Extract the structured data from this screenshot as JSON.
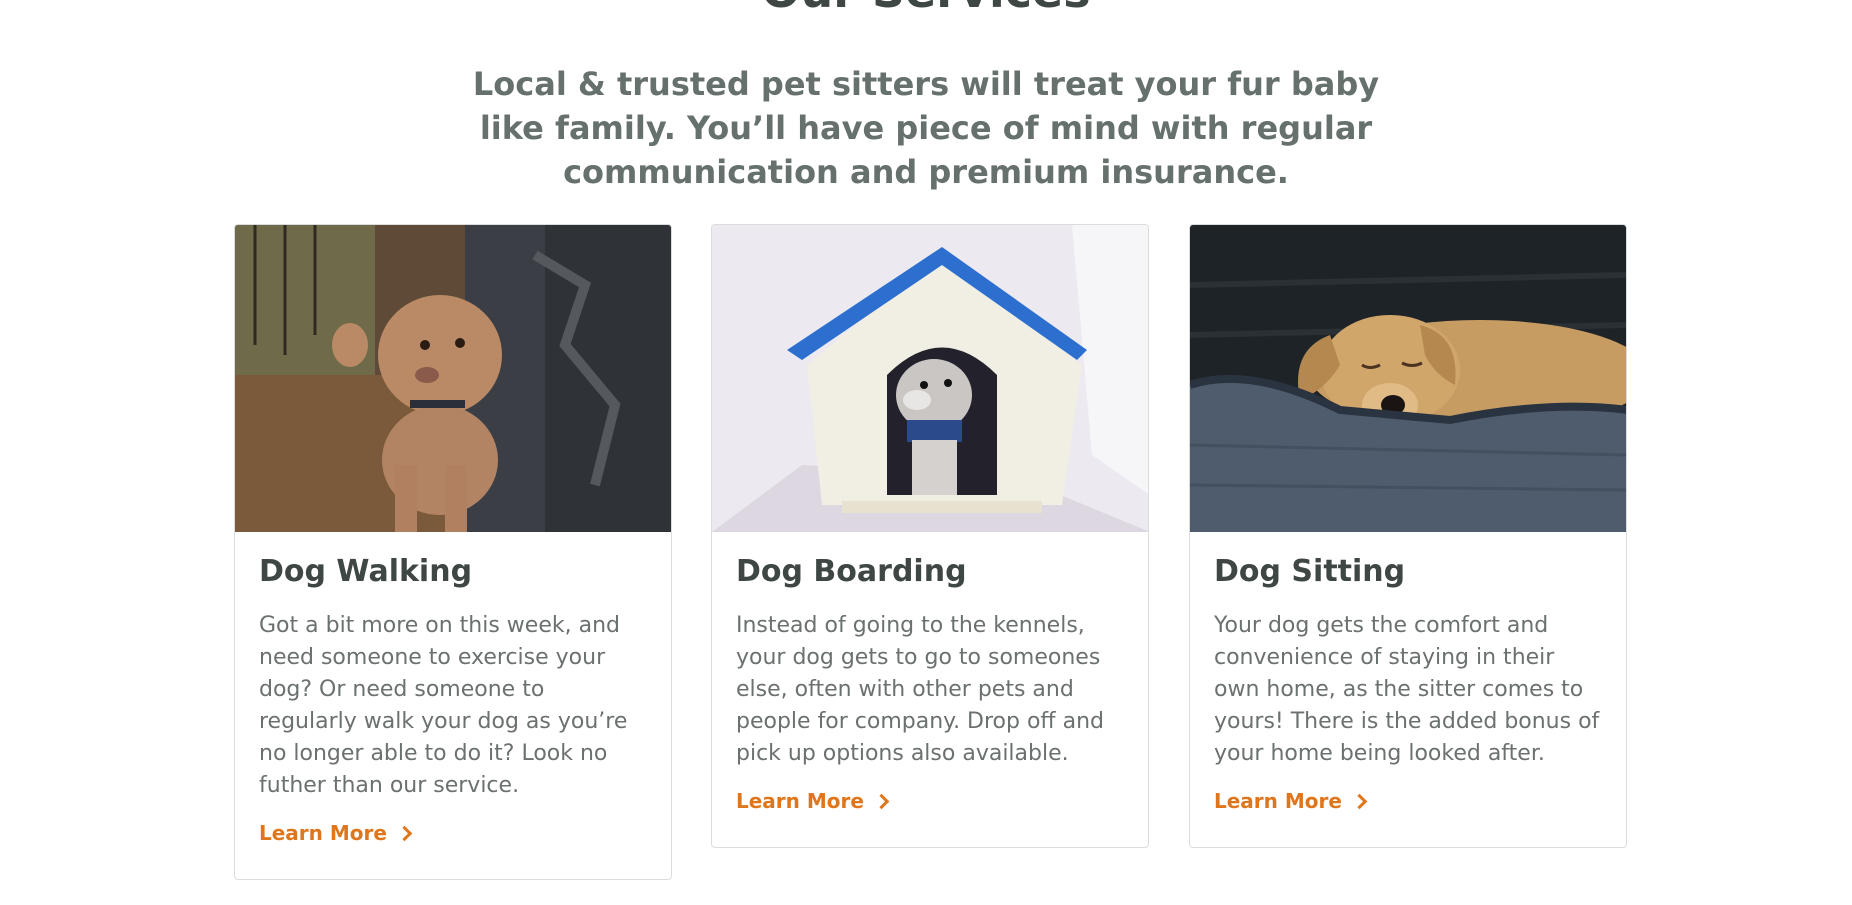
{
  "services": {
    "title": "Our Services",
    "subtitle": "Local & trusted pet sitters will treat your fur baby like family. You’ll have piece of mind with regular communication and premium insurance.",
    "cards": [
      {
        "title": "Dog Walking",
        "text": "Got a bit more on this week, and need someone to exercise your dog? Or need someone to regularly walk your dog as you’re no longer able to do it? Look no futher than our service.",
        "link": "Learn More",
        "image_icon": "poodle-photo"
      },
      {
        "title": "Dog Boarding",
        "text": "Instead of going to the kennels, your dog gets to go to someones else, often with other pets and people for company. Drop off and pick up options also available.",
        "link": "Learn More",
        "image_icon": "doghouse-photo"
      },
      {
        "title": "Dog Sitting",
        "text": "Your dog gets the comfort and convenience of staying in their own home, as the sitter comes to yours! There is the added bonus of your home being looked after.",
        "link": "Learn More",
        "image_icon": "sleeping-dog-photo"
      }
    ]
  },
  "colors": {
    "accent": "#e0761c",
    "heading": "#3f4744",
    "body_text": "#6a716e"
  }
}
